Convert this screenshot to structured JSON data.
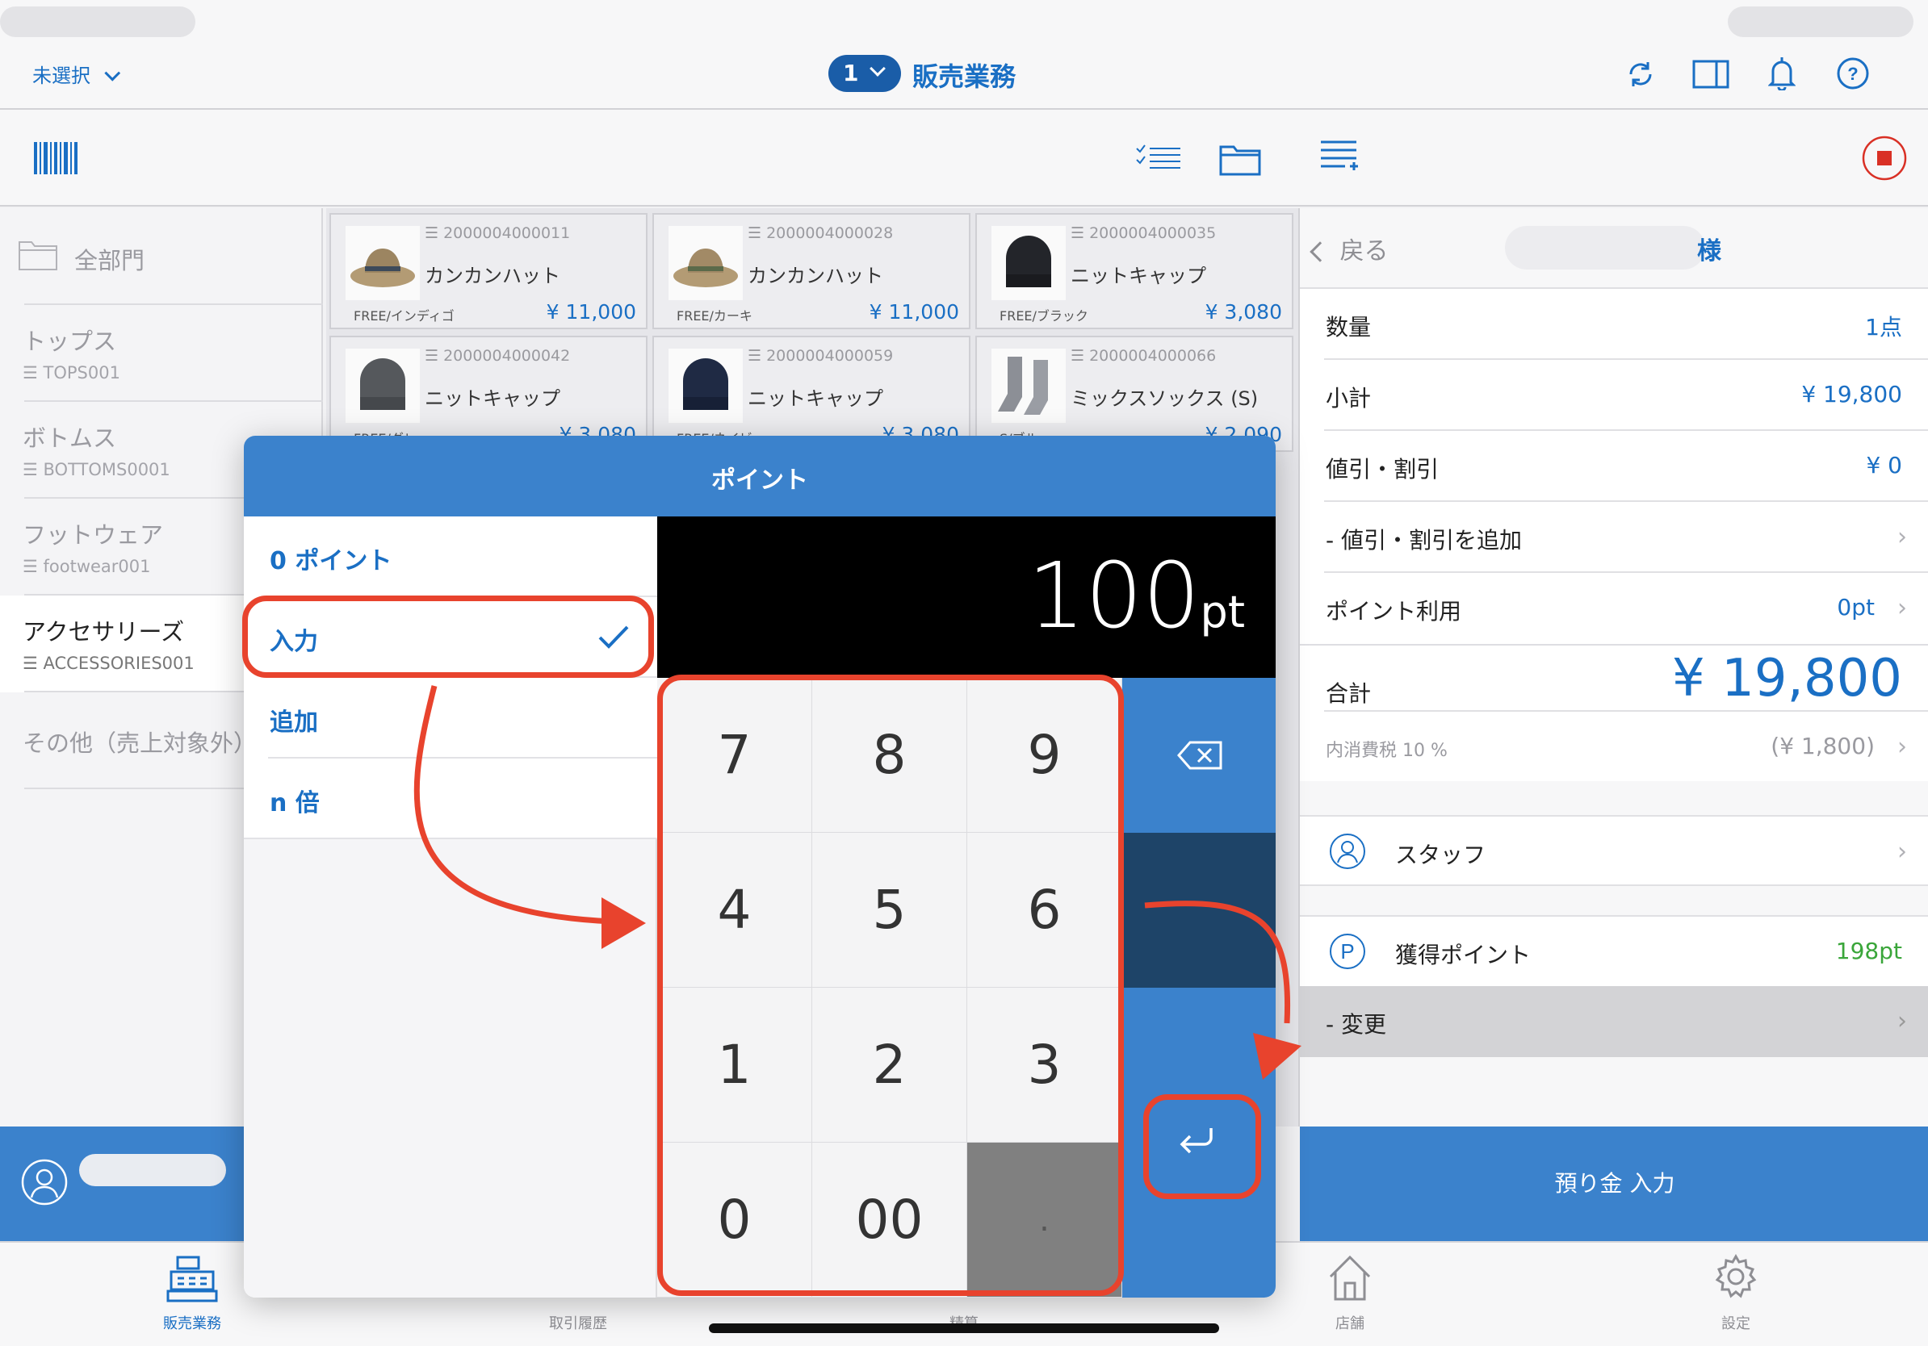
{
  "topbar": {
    "unselected_label": "未選択",
    "register_number": "1",
    "title": "販売業務"
  },
  "categories": [
    {
      "name": "全部門",
      "code": ""
    },
    {
      "name": "トップス",
      "code": "☰ TOPS001"
    },
    {
      "name": "ボトムス",
      "code": "☰ BOTTOMS0001"
    },
    {
      "name": "フットウェア",
      "code": "☰ footwear001"
    },
    {
      "name": "アクセサリーズ",
      "code": "☰ ACCESSORIES001"
    },
    {
      "name": "その他（売上対象外）",
      "code": ""
    }
  ],
  "products": [
    {
      "code": "☰ 2000004000011",
      "name": "カンカンハット",
      "variant": "FREE/インディゴ",
      "price": "¥ 11,000"
    },
    {
      "code": "☰ 2000004000028",
      "name": "カンカンハット",
      "variant": "FREE/カーキ",
      "price": "¥ 11,000"
    },
    {
      "code": "☰ 2000004000035",
      "name": "ニットキャップ",
      "variant": "FREE/ブラック",
      "price": "¥ 3,080"
    },
    {
      "code": "☰ 2000004000042",
      "name": "ニットキャップ",
      "variant": "FREE/グレー",
      "price": "¥ 3,080"
    },
    {
      "code": "☰ 2000004000059",
      "name": "ニットキャップ",
      "variant": "FREE/ネイビー",
      "price": "¥ 3,080"
    },
    {
      "code": "☰ 2000004000066",
      "name": "ミックスソックス (S)",
      "variant": "S/ブルー",
      "price": "¥ 2,090"
    }
  ],
  "right": {
    "back_label": "戻る",
    "customer_suffix": "様",
    "quantity_label": "数量",
    "quantity_value": "1点",
    "subtotal_label": "小計",
    "subtotal_value": "¥ 19,800",
    "discount_label": "値引・割引",
    "discount_value": "¥ 0",
    "add_discount_label": "- 値引・割引を追加",
    "points_use_label": "ポイント利用",
    "points_use_value": "0pt",
    "total_label": "合計",
    "total_value": "¥ 19,800",
    "tax_label": "内消費税 10 %",
    "tax_value": "(¥ 1,800)",
    "staff_label": "スタッフ",
    "earned_points_label": "獲得ポイント",
    "earned_points_value": "198pt",
    "change_label": "- 変更",
    "deposit_button": "預り金 入力"
  },
  "dialog": {
    "title": "ポイント",
    "options": [
      "0 ポイント",
      "入力",
      "追加",
      "n 倍"
    ],
    "selected_option": "入力",
    "display_value": "100",
    "display_unit": "pt",
    "keys": [
      "7",
      "8",
      "9",
      "4",
      "5",
      "6",
      "1",
      "2",
      "3",
      "0",
      "00",
      "."
    ]
  },
  "tabs": [
    "販売業務",
    "取引履歴",
    "精算",
    "店舗",
    "設定"
  ],
  "colors": {
    "accent": "#1a6fc4",
    "dialog_header": "#3b82cc",
    "annotation": "#e8432d",
    "earned_points": "#3aa63a",
    "dark_key": "#1e4468"
  }
}
